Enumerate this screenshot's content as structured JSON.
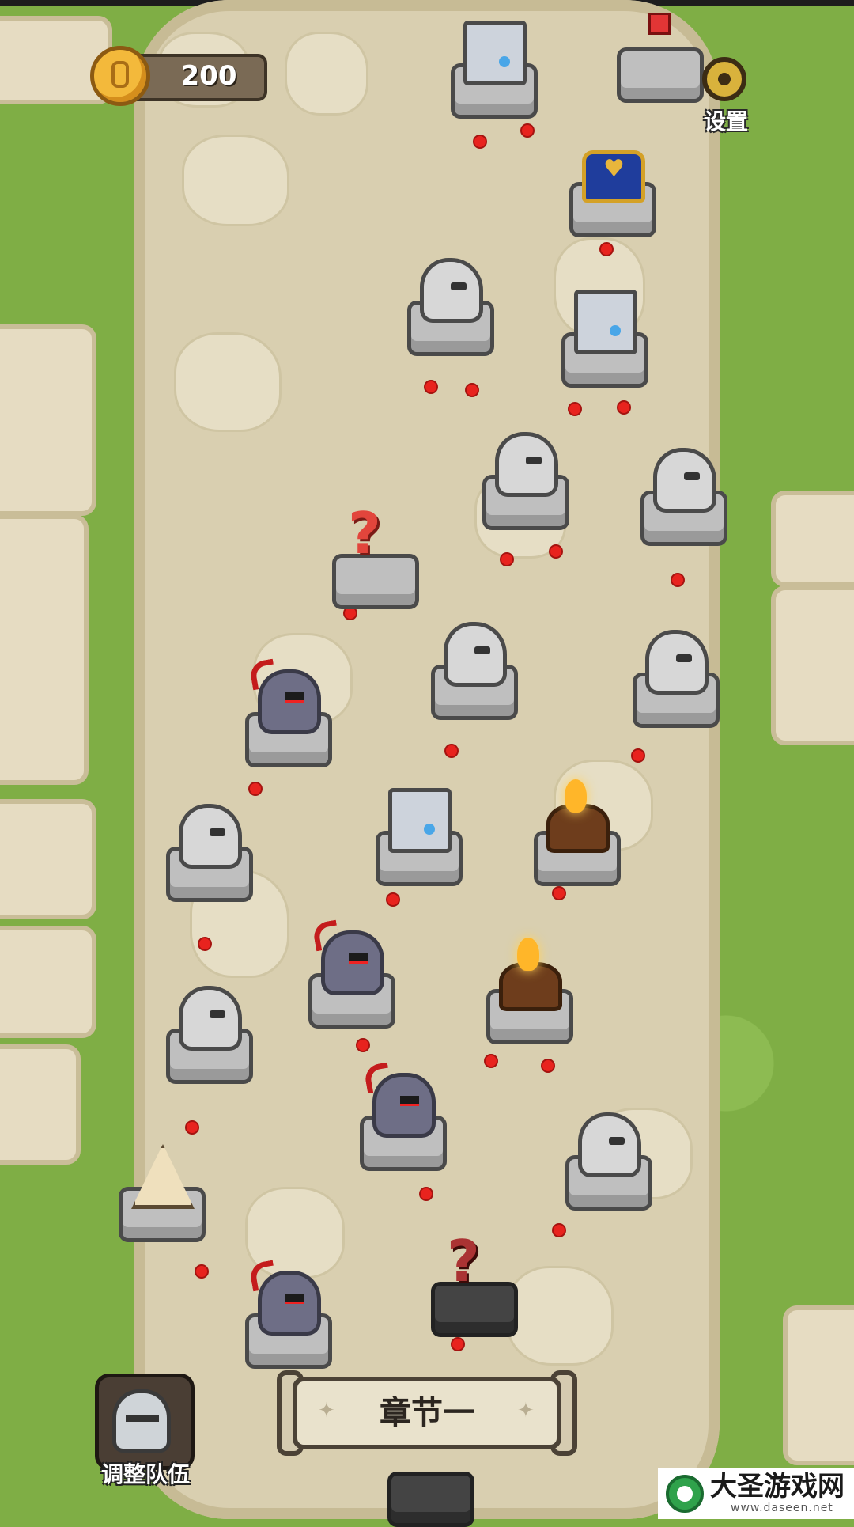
{
  "hud": {
    "coins": "200",
    "settings_label": "设置"
  },
  "chapter": {
    "title": "章节一"
  },
  "team_button": {
    "label": "调整队伍"
  },
  "map": {
    "nodes": [
      {
        "type": "tower",
        "state": "normal"
      },
      {
        "type": "red-cube-gem",
        "state": "normal"
      },
      {
        "type": "treasure-chest",
        "state": "normal"
      },
      {
        "type": "knight",
        "state": "normal"
      },
      {
        "type": "tower",
        "state": "normal"
      },
      {
        "type": "knight",
        "state": "normal"
      },
      {
        "type": "knight",
        "state": "normal"
      },
      {
        "type": "mystery",
        "state": "normal"
      },
      {
        "type": "knight",
        "state": "normal"
      },
      {
        "type": "knight",
        "state": "normal"
      },
      {
        "type": "demon-knight",
        "state": "normal"
      },
      {
        "type": "tower",
        "state": "normal"
      },
      {
        "type": "campfire",
        "state": "normal"
      },
      {
        "type": "knight",
        "state": "normal"
      },
      {
        "type": "demon-knight",
        "state": "normal"
      },
      {
        "type": "campfire",
        "state": "normal"
      },
      {
        "type": "knight",
        "state": "normal"
      },
      {
        "type": "demon-knight",
        "state": "normal"
      },
      {
        "type": "knight",
        "state": "normal"
      },
      {
        "type": "tent",
        "state": "normal"
      },
      {
        "type": "demon-knight",
        "state": "normal"
      },
      {
        "type": "mystery",
        "state": "dark"
      },
      {
        "type": "start",
        "state": "dark"
      }
    ]
  },
  "watermark": {
    "text": "大圣游戏网",
    "url": "www.daseen.net"
  },
  "colors": {
    "grass": "#7fae45",
    "path": "#d9cfb0",
    "route_dot": "#e8231e",
    "coin": "#f3b93b"
  }
}
